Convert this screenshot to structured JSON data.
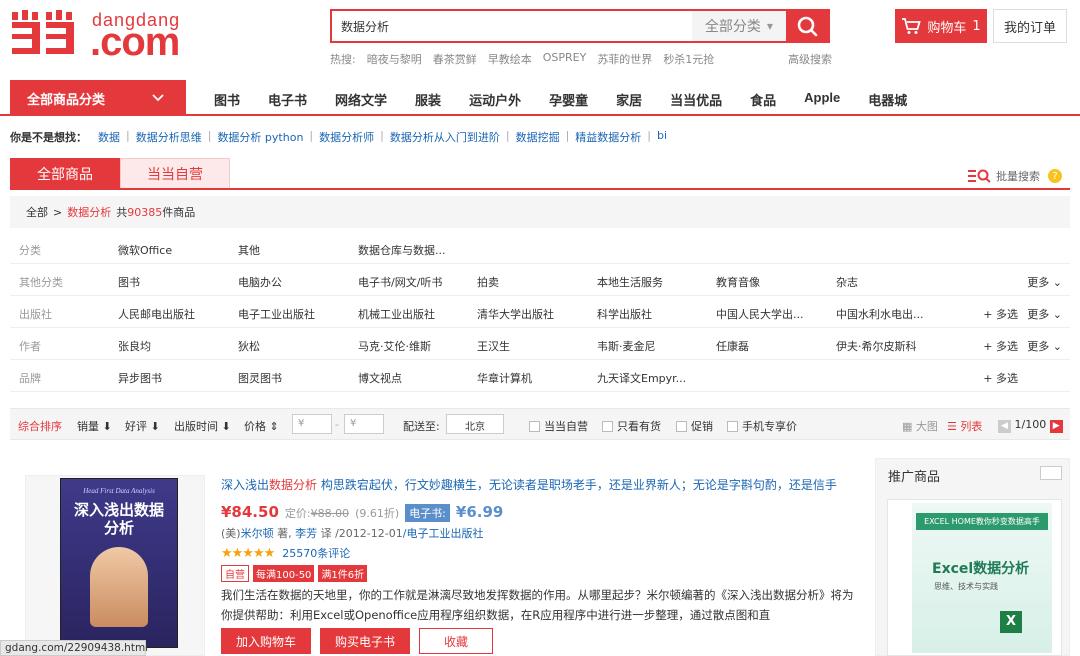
{
  "logo": {
    "en": "dangdang",
    "com": ".com",
    "mark": "当当"
  },
  "search": {
    "value": "数据分析",
    "category": "全部分类"
  },
  "hot": {
    "label": "热搜:",
    "items": [
      "暗夜与黎明",
      "春茶赏鲜",
      "早教绘本",
      "OSPREY",
      "苏菲的世界",
      "秒杀1元抢"
    ],
    "advanced": "高级搜索"
  },
  "cart": {
    "label": "购物车",
    "count": "1"
  },
  "orders": "我的订单",
  "nav": {
    "all": "全部商品分类",
    "items": [
      "图书",
      "电子书",
      "网络文学",
      "服装",
      "运动户外",
      "孕婴童",
      "家居",
      "当当优品",
      "食品",
      "Apple",
      "电器城"
    ]
  },
  "suggest": {
    "label": "你是不是想找：",
    "items": [
      "数据",
      "数据分析思维",
      "数据分析 python",
      "数据分析师",
      "数据分析从入门到进阶",
      "数据挖掘",
      "精益数据分析",
      "bi"
    ]
  },
  "tabs": [
    "全部商品",
    "当当自营"
  ],
  "batch": "批量搜索",
  "crumb": {
    "root": "全部",
    "sep": ">",
    "keyword": "数据分析",
    "pre": "共",
    "count": "90385",
    "post": "件商品"
  },
  "filters": [
    {
      "label": "分类",
      "options": [
        "微软Office",
        "其他",
        "数据仓库与数据..."
      ],
      "multi": "",
      "more": ""
    },
    {
      "label": "其他分类",
      "options": [
        "图书",
        "电脑办公",
        "电子书/网文/听书",
        "拍卖",
        "本地生活服务",
        "教育音像",
        "杂志"
      ],
      "multi": "",
      "more": "更多"
    },
    {
      "label": "出版社",
      "options": [
        "人民邮电出版社",
        "电子工业出版社",
        "机械工业出版社",
        "清华大学出版社",
        "科学出版社",
        "中国人民大学出...",
        "中国水利水电出..."
      ],
      "multi": "+ 多选",
      "more": "更多"
    },
    {
      "label": "作者",
      "options": [
        "张良均",
        "狄松",
        "马克·艾伦·维斯",
        "王汉生",
        "韦斯·麦金尼",
        "任康磊",
        "伊夫·希尔皮斯科"
      ],
      "multi": "+ 多选",
      "more": "更多"
    },
    {
      "label": "品牌",
      "options": [
        "异步图书",
        "图灵图书",
        "博文视点",
        "华章计算机",
        "九天译文Empyr..."
      ],
      "multi": "+ 多选",
      "more": ""
    }
  ],
  "sort": {
    "items": [
      "综合排序",
      "销量",
      "好评",
      "出版时间",
      "价格"
    ],
    "price_ph": "¥",
    "ship_label": "配送至:",
    "ship_city": "北京",
    "checks": [
      "当当自营",
      "只看有货",
      "促销",
      "手机专享价"
    ],
    "view_big": "大图",
    "view_list": "列表",
    "page": "1/100"
  },
  "product": {
    "title_pre": "深入浅出",
    "title_hl": "数据分析",
    "title_post": " 构思跌宕起伏，行文妙趣横生，无论读者是职场老手，还是业界新人；无论是字斟句酌，还是信手",
    "price": "¥84.50",
    "orig_label": "定价:",
    "orig": "¥88.00",
    "discount": "(9.61折)",
    "ebook_label": "电子书:",
    "ebook_price": "¥6.99",
    "author_pre": "(美)",
    "author": "米尔顿",
    "author_suf": "著,",
    "translator": "李芳",
    "translator_suf": "译",
    "date": "/2012-12-01",
    "publisher": "/电子工业出版社",
    "stars": "★★★★★",
    "reviews": "25570条评论",
    "tags": [
      "自营",
      "每满100-50",
      "满1件6折"
    ],
    "desc": "我们生活在数据的天地里，你的工作就是淋漓尽致地发挥数据的作用。从哪里起步？米尔顿编著的《深入浅出数据分析》将为你提供帮助：利用Excel或Openoffice应用程序组织数据，在R应用程序中进行进一步整理，通过散点图和直",
    "book_en": "Head First Data Analysis",
    "book_cn": "深入浅出数据分析",
    "btn_cart": "加入购物车",
    "btn_ebook": "购买电子书",
    "btn_fav": "收藏"
  },
  "promo": {
    "title": "推广商品",
    "banner": "EXCEL HOME教你秒变数据高手",
    "book": "Excel数据分析",
    "sub": "思维、技术与实践"
  },
  "status_url": "gdang.com/22909438.html"
}
